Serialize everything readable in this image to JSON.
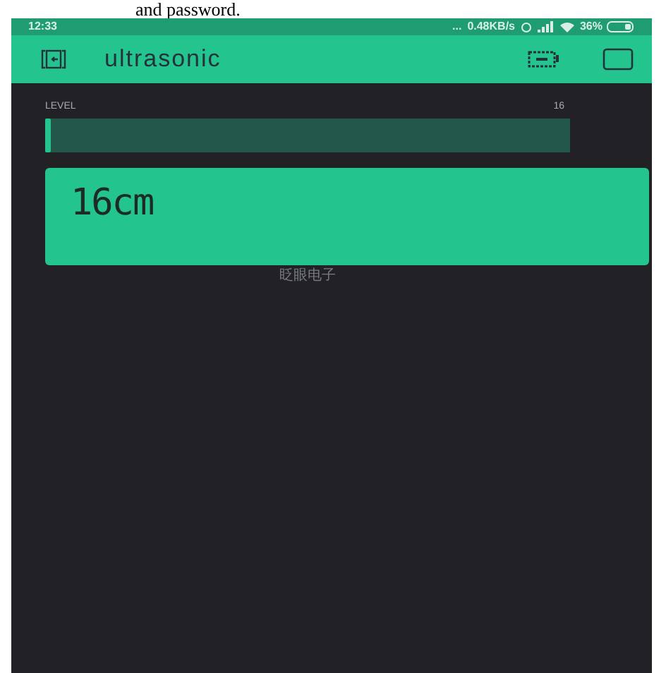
{
  "document_text": "and password.",
  "status_bar": {
    "time": "12:33",
    "dots": "...",
    "speed": "0.48KB/s",
    "battery": "36%"
  },
  "app_bar": {
    "title": "ultrasonic"
  },
  "level_widget": {
    "label": "LEVEL",
    "reading": "16",
    "level": 0.012
  },
  "value_display": {
    "value": "16cm",
    "caption": "眨眼电子"
  }
}
